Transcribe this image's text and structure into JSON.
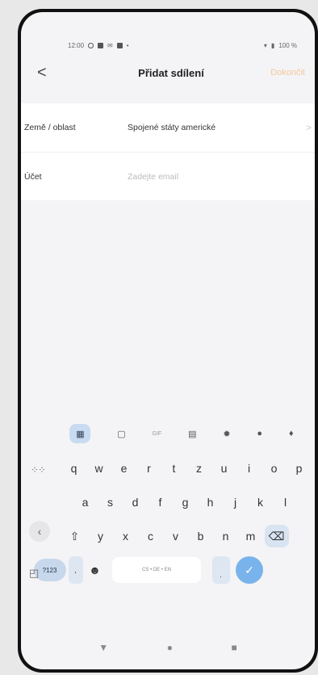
{
  "status": {
    "time": "12:00",
    "battery": "100 %"
  },
  "nav": {
    "back_symbol": "<",
    "title": "Přidat sdílení",
    "done": "Dokončit"
  },
  "form": {
    "region_label": "Země / oblast",
    "region_value": "Spojené státy americké",
    "region_chevron": ">",
    "account_label": "Účet",
    "account_placeholder": "Zadejte email"
  },
  "keyboard": {
    "toolbar": {
      "gif": "GIF"
    },
    "row1": [
      "q",
      "w",
      "e",
      "r",
      "t",
      "z",
      "u",
      "i",
      "o",
      "p"
    ],
    "row2": [
      "a",
      "s",
      "d",
      "f",
      "g",
      "h",
      "j",
      "k",
      "l"
    ],
    "row3": [
      "y",
      "x",
      "c",
      "v",
      "b",
      "n",
      "m"
    ],
    "num_label": "?123",
    "space_label": "CS • DE • EN",
    "period": "."
  },
  "icons": {
    "back": "chevron-left-icon",
    "apps": "apps-grid-icon",
    "sticker": "sticker-icon",
    "clipboard": "clipboard-icon",
    "settings": "gear-icon",
    "palette": "palette-icon",
    "mic": "microphone-icon",
    "shift": "shift-icon",
    "backspace": "backspace-icon",
    "enter": "check-icon"
  }
}
